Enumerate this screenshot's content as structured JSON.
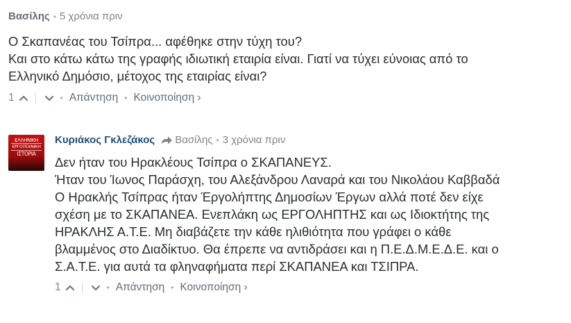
{
  "comments": [
    {
      "author": "Βασίλης",
      "time": "5 χρόνια πριν",
      "lines": [
        "Ο Σκαπανέας του Τσίπρα... αφέθηκε στην τύχη του?",
        "Και στο κάτω κάτω της γραφής ιδιωτική εταιρία είναι. Γιατί να τύχει εύνοιας από το",
        "Ελληνικό Δημόσιο, μέτοχος της εταιρίας είναι?"
      ],
      "votes": "1",
      "reply_label": "Απάντηση",
      "share_label": "Κοινοποίηση ›"
    },
    {
      "author": "Κυριάκος Γκλεζάκος",
      "reply_to": "Βασίλης",
      "time": "3 χρόνια πριν",
      "avatar_text": [
        "ΕΛΛΗΝΙΚΗ",
        "ΕΡΓΟΤΕΧΝΙΚΗ",
        "ΙΣΤΟΡΙΑ"
      ],
      "lines": [
        "Δεν ήταν του Ηρακλέους Τσίπρα ο ΣΚΑΠΑΝΕΥΣ.",
        "Ήταν του Ίωνος Παράσχη, του Αλεξάνδρου Λαναρά και του Νικολάου Καββαδά",
        "Ο Ηρακλής Τσίπρας ήταν Έργολήπτης Δημοσίων Έργων αλλά ποτέ δεν είχε",
        "σχέση με το ΣΚΑΠΑΝΕΑ. Ενεπλάκη ως ΕΡΓΟΛΗΠΤΗΣ και ως Ιδιοκτήτης της",
        "ΗΡΑΚΛΗΣ Α.Τ.Ε. Μη διαβάζετε την κάθε ηλιθιότητα που γράφει ο κάθε",
        "βλαμμένος στο Διαδίκτυο. Θα έπρεπε να αντιδράσει και η Π.Ε.Δ.Μ.Ε.Δ.Ε. και ο",
        "Σ.Α.Τ.Ε. για αυτά τα φληναφήματα περί ΣΚΑΠΑΝΕΑ και ΤΣΙΠΡΑ."
      ],
      "votes": "1",
      "reply_label": "Απάντηση",
      "share_label": "Κοινοποίηση ›"
    }
  ],
  "colors": {
    "author_grey": "#656c7a",
    "author_blue": "#1f4e79",
    "text": "#2a2e2e",
    "muted": "#7f8489",
    "avatar_red": "#c21414"
  }
}
